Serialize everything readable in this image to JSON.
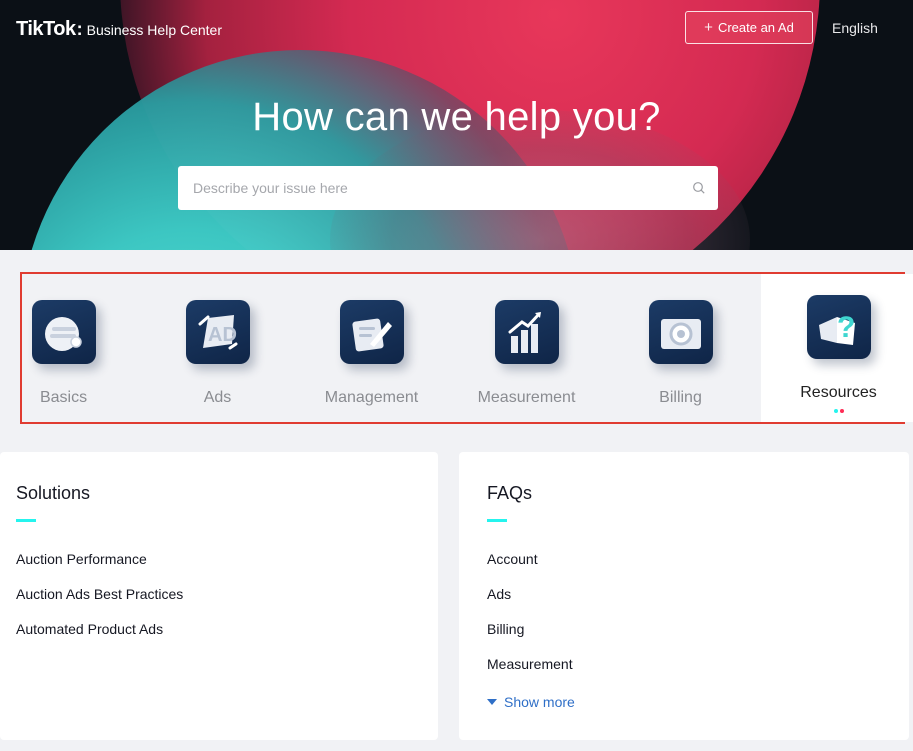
{
  "header": {
    "logo": "TikTok",
    "subtitle": "Business Help Center",
    "create_ad_label": "Create an Ad",
    "language": "English"
  },
  "hero": {
    "title": "How can we help you?",
    "search_placeholder": "Describe your issue here"
  },
  "categories": [
    {
      "label": "Basics",
      "icon": "basics-icon"
    },
    {
      "label": "Ads",
      "icon": "ads-icon"
    },
    {
      "label": "Management",
      "icon": "management-icon"
    },
    {
      "label": "Measurement",
      "icon": "measurement-icon"
    },
    {
      "label": "Billing",
      "icon": "billing-icon"
    },
    {
      "label": "Resources",
      "icon": "resources-icon",
      "selected": true
    }
  ],
  "solutions": {
    "title": "Solutions",
    "items": [
      "Auction Performance",
      "Auction Ads Best Practices",
      "Automated Product Ads"
    ]
  },
  "faqs": {
    "title": "FAQs",
    "items": [
      "Account",
      "Ads",
      "Billing",
      "Measurement"
    ],
    "show_more": "Show more"
  },
  "colors": {
    "accent_teal": "#25f4ee",
    "accent_pink": "#fe2c55",
    "link_blue": "#2f6fc7",
    "highlight_border": "#e03c31"
  }
}
